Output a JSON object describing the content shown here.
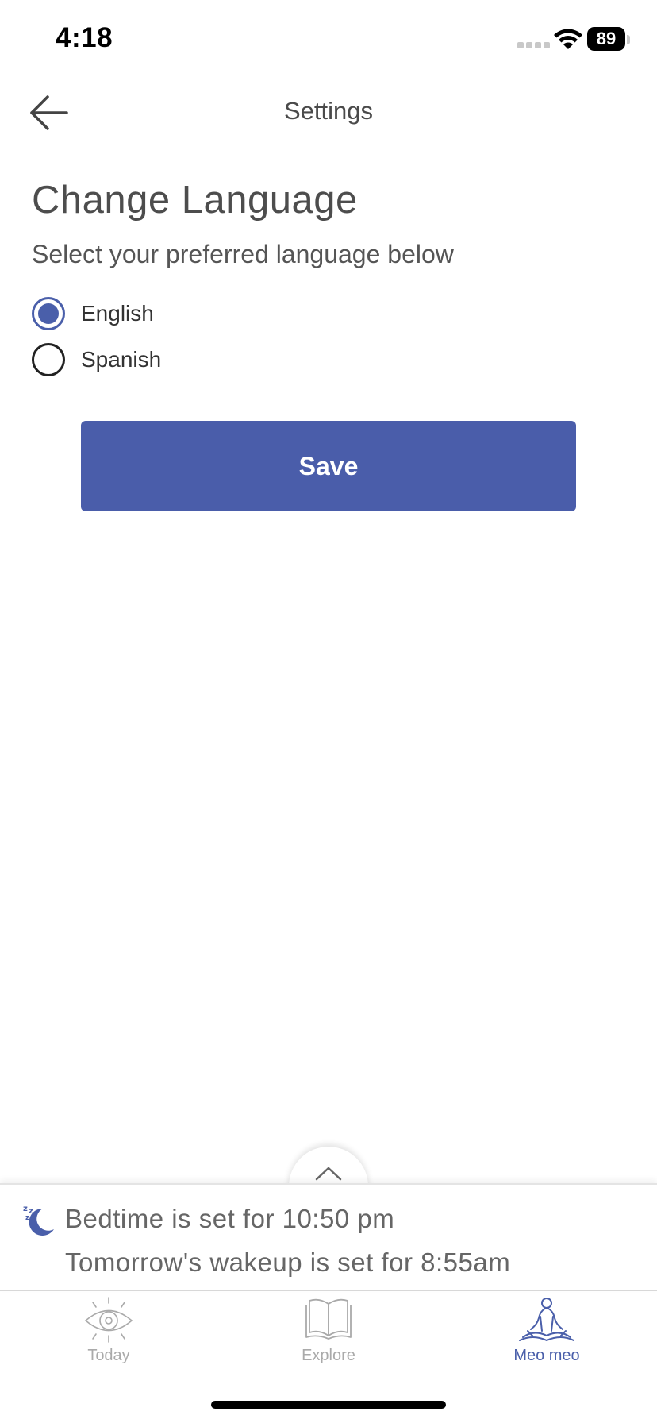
{
  "status_bar": {
    "time": "4:18",
    "battery": "89"
  },
  "header": {
    "title": "Settings",
    "back_icon": "arrow-left-icon"
  },
  "content": {
    "title": "Change Language",
    "subtitle": "Select your preferred language below",
    "options": [
      {
        "label": "English",
        "selected": true
      },
      {
        "label": "Spanish",
        "selected": false
      }
    ],
    "save_label": "Save"
  },
  "sheet": {
    "bedtime": "Bedtime is set for 10:50 pm",
    "wakeup": "Tomorrow's wakeup is set for 8:55am",
    "handle_icon": "chevron-up-icon",
    "moon_icon": "sleep-moon-icon"
  },
  "tabs": [
    {
      "label": "Today",
      "icon": "eye-icon",
      "active": false
    },
    {
      "label": "Explore",
      "icon": "book-icon",
      "active": false
    },
    {
      "label": "Meo meo",
      "icon": "meditation-icon",
      "active": true
    }
  ],
  "colors": {
    "accent": "#4a5daa",
    "text": "#4a4a4a",
    "tab_inactive": "#aaaaaa"
  }
}
